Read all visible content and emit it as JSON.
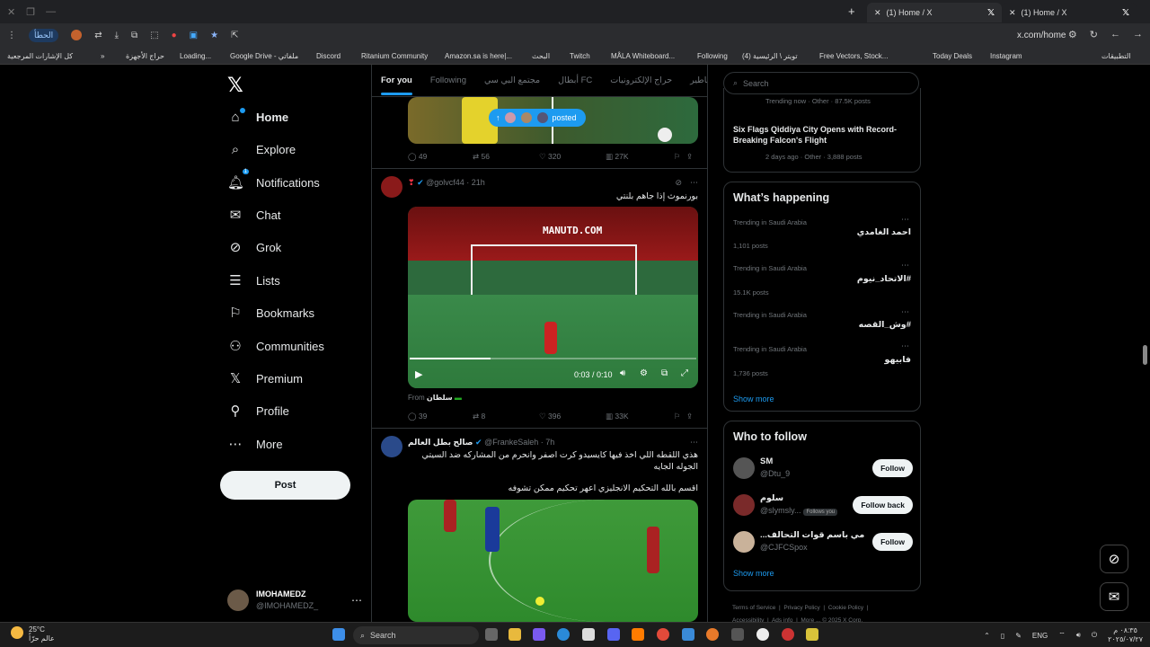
{
  "browser": {
    "tabs": [
      {
        "title": "(1) Home / X"
      },
      {
        "title": "(1) Home / X"
      }
    ],
    "error_pill": "الحطأ",
    "url": "x.com/home",
    "bookmarks": [
      "كل الإشارات المرجعية",
      "حراج الأجهزة",
      "Loading...",
      "Google Drive - ملفاتي",
      "Discord",
      "Ritanium Community",
      "Amazon.sa is here|...",
      "البحث",
      "Twitch",
      "MÅLA Whiteboard...",
      "Following",
      "(4) تويتر \\ الرئيسية",
      "Free Vectors, Stock...",
      "Today Deals",
      "Instagram",
      "التطبيقات"
    ]
  },
  "nav": {
    "items": [
      {
        "label": "Home",
        "icon": "home-icon"
      },
      {
        "label": "Explore",
        "icon": "search-icon"
      },
      {
        "label": "Notifications",
        "icon": "bell-icon",
        "badge": "1"
      },
      {
        "label": "Chat",
        "icon": "envelope-icon"
      },
      {
        "label": "Grok",
        "icon": "grok-icon"
      },
      {
        "label": "Lists",
        "icon": "list-icon"
      },
      {
        "label": "Bookmarks",
        "icon": "bookmark-icon"
      },
      {
        "label": "Communities",
        "icon": "communities-icon"
      },
      {
        "label": "Premium",
        "icon": "x-logo-icon"
      },
      {
        "label": "Profile",
        "icon": "person-icon"
      },
      {
        "label": "More",
        "icon": "more-circle-icon"
      }
    ],
    "post_button": "Post",
    "account": {
      "name": "IMOHAMEDZ",
      "handle": "@IMOHAMEDZ_"
    }
  },
  "feed": {
    "tabs": [
      "For you",
      "Following",
      "مجتمع البي سي",
      "أبطال FC",
      "حراج الإلكترونيات",
      "أساطير"
    ],
    "posted_pill": "posted",
    "tweet0": {
      "replies": "49",
      "retweets": "56",
      "likes": "320",
      "views": "27K"
    },
    "tweet1": {
      "handle": "@golvcf44",
      "time": "21h",
      "text": "بورنموث إذا جاهم بلنتي",
      "video_time": "0:03 / 0:10",
      "from_label": "From",
      "from_name": "سلطان",
      "scoreboard_text": "MANUTD.COM",
      "replies": "39",
      "retweets": "8",
      "likes": "396",
      "views": "33K"
    },
    "tweet2": {
      "name": "صالح بطل العالم",
      "handle": "@FrankeSaleh",
      "time": "7h",
      "text1": "هذي اللقطه اللي اخذ فيها كايسيدو كرت اصفر وانحرم من المشاركه ضد السيتي الجوله الجايه",
      "text2": "اقسم بالله التحكيم الانجليزي اعهر تحكيم ممكن تشوفه"
    }
  },
  "right": {
    "search_placeholder": "Search",
    "top_trends": [
      {
        "meta": "Trending now · Other · 87.5K posts"
      },
      {
        "title": "Six Flags Qiddiya City Opens with Record-Breaking Falcon's Flight",
        "meta": "2 days ago · Other · 3,888 posts"
      }
    ],
    "happening_title": "What’s happening",
    "trends": [
      {
        "context": "Trending in Saudi Arabia",
        "name": "احمد الغامدي",
        "count": "1,101 posts"
      },
      {
        "context": "Trending in Saudi Arabia",
        "name": "#الاتحاد_نيوم",
        "count": "15.1K posts"
      },
      {
        "context": "Trending in Saudi Arabia",
        "name": "#وش_القصه",
        "count": ""
      },
      {
        "context": "Trending in Saudi Arabia",
        "name": "فابيهو",
        "count": "1,736 posts"
      }
    ],
    "show_more": "Show more",
    "who_title": "Who to follow",
    "who": [
      {
        "name": "SM",
        "handle": "@Dtu_9",
        "button": "Follow",
        "follows_you": ""
      },
      {
        "name": "سلوم",
        "handle": "@slymsly...",
        "button": "Follow back",
        "follows_you": "Follows you"
      },
      {
        "name": "...مي باسم قوات التحالف",
        "handle": "@CJFCSpox",
        "button": "Follow",
        "follows_you": ""
      }
    ],
    "footer": [
      "Terms of Service",
      "Privacy Policy",
      "Cookie Policy",
      "Accessibility",
      "Ads info",
      "More ...",
      "© 2025 X Corp."
    ]
  },
  "taskbar": {
    "temp": "25°C",
    "weather_text": "عالم حرّاً",
    "search": "Search",
    "lang": "ENG",
    "time": "٠٨:٣٥ م",
    "date": "٢٠٢٥/٠٧/٢٧"
  },
  "colors": {
    "accent": "#1d9bf0",
    "bg": "#000000",
    "border": "#2f3336",
    "muted": "#71767b"
  }
}
